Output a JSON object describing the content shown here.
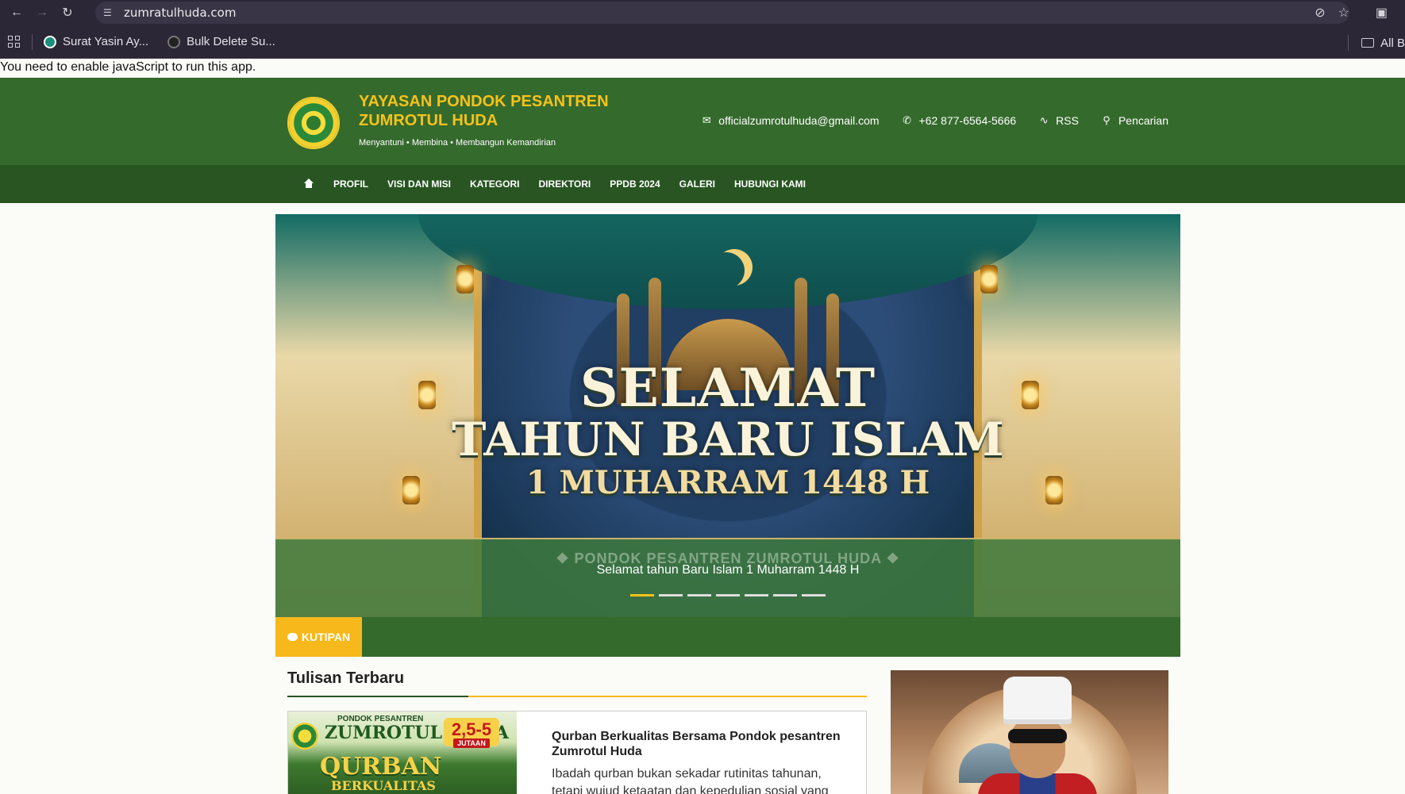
{
  "browser": {
    "url": "zumratulhuda.com",
    "bookmarks": [
      {
        "label": "Surat Yasin Ay..."
      },
      {
        "label": "Bulk Delete Su..."
      }
    ],
    "all_bookmarks_label": "All B"
  },
  "noscript_text": "You need to enable javaScript to run this app.",
  "header": {
    "title_line1": "YAYASAN PONDOK PESANTREN",
    "title_line2": "ZUMROTUL HUDA",
    "tagline": "Menyantuni • Membina • Membangun Kemandirian",
    "email": "officialzumrotulhuda@gmail.com",
    "phone": "+62 877-6564-5666",
    "rss_label": "RSS",
    "search_label": "Pencarian"
  },
  "nav": {
    "items": [
      "PROFIL",
      "VISI DAN MISI",
      "KATEGORI",
      "DIREKTORI",
      "PPDB 2024",
      "GALERI",
      "HUBUNGI KAMI"
    ]
  },
  "slider": {
    "banner_line1": "SELAMAT",
    "banner_line2": "TAHUN BARU ISLAM",
    "banner_line3": "1 MUHARRAM 1448 H",
    "watermark": "❖ PONDOK PESANTREN ZUMROTUL HUDA ❖",
    "caption": "Selamat tahun Baru Islam 1 Muharram 1448 H",
    "slide_count": 7,
    "active_slide": 1
  },
  "quote": {
    "label": "KUTIPAN"
  },
  "latest": {
    "section_title": "Tulisan Terbaru",
    "post": {
      "title": "Qurban Berkualitas Bersama Pondok pesantren Zumrotul Huda",
      "excerpt": "Ibadah qurban bukan sekadar rutinitas tahunan, tetapi wujud ketaatan dan kepedulian sosial yang",
      "thumb": {
        "line1": "PONDOK PESANTREN",
        "line2": "ZUMROTUL HUDA",
        "line3": "QURBAN",
        "line4": "BERKUALITAS",
        "price": "2,5-5",
        "price_unit": "JUTAAN"
      }
    }
  },
  "colors": {
    "header_green": "#356a2d",
    "nav_green": "#285522",
    "accent_gold": "#f6c21a",
    "tag_orange": "#f6b81a"
  }
}
